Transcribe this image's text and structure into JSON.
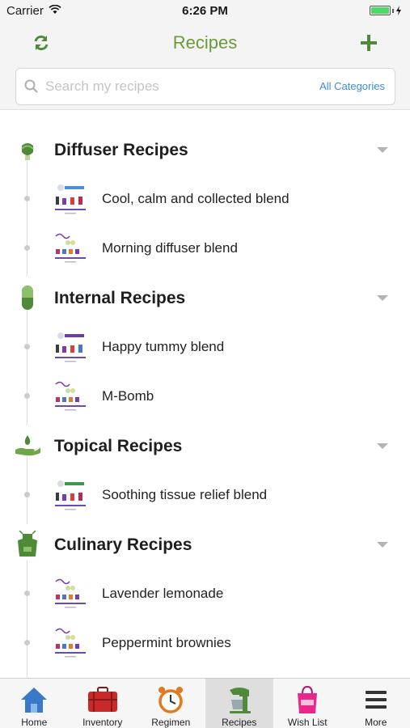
{
  "status_bar": {
    "carrier": "Carrier",
    "time": "6:26 PM"
  },
  "nav": {
    "title": "Recipes",
    "refresh_icon": "refresh-icon",
    "add_icon": "plus-icon"
  },
  "search": {
    "placeholder": "Search my recipes",
    "value": "",
    "category_label": "All Categories"
  },
  "sections": [
    {
      "title": "Diffuser Recipes",
      "icon": "diffuser-icon",
      "recipes": [
        {
          "name": "Cool, calm and collected blend",
          "thumb": "blend-card"
        },
        {
          "name": "Morning diffuser blend",
          "thumb": "recipes-card"
        }
      ]
    },
    {
      "title": "Internal Recipes",
      "icon": "capsule-icon",
      "recipes": [
        {
          "name": "Happy tummy blend",
          "thumb": "blend-card"
        },
        {
          "name": "M-Bomb",
          "thumb": "recipes-card"
        }
      ]
    },
    {
      "title": "Topical Recipes",
      "icon": "hand-drop-icon",
      "recipes": [
        {
          "name": "Soothing tissue relief blend",
          "thumb": "blend-card"
        }
      ]
    },
    {
      "title": "Culinary Recipes",
      "icon": "apron-icon",
      "recipes": [
        {
          "name": "Lavender lemonade",
          "thumb": "recipes-card"
        },
        {
          "name": "Peppermint brownies",
          "thumb": "recipes-card"
        }
      ]
    }
  ],
  "tabs": [
    {
      "label": "Home",
      "icon": "home-icon",
      "active": false
    },
    {
      "label": "Inventory",
      "icon": "suitcase-icon",
      "active": false
    },
    {
      "label": "Regimen",
      "icon": "alarm-clock-icon",
      "active": false
    },
    {
      "label": "Recipes",
      "icon": "mixer-icon",
      "active": true
    },
    {
      "label": "Wish List",
      "icon": "shopping-bag-icon",
      "active": false
    },
    {
      "label": "More",
      "icon": "menu-icon",
      "active": false
    }
  ],
  "colors": {
    "accent_green": "#6a9a3a",
    "link_blue": "#3a8ed8",
    "icon_green": "#4e8a3a"
  }
}
